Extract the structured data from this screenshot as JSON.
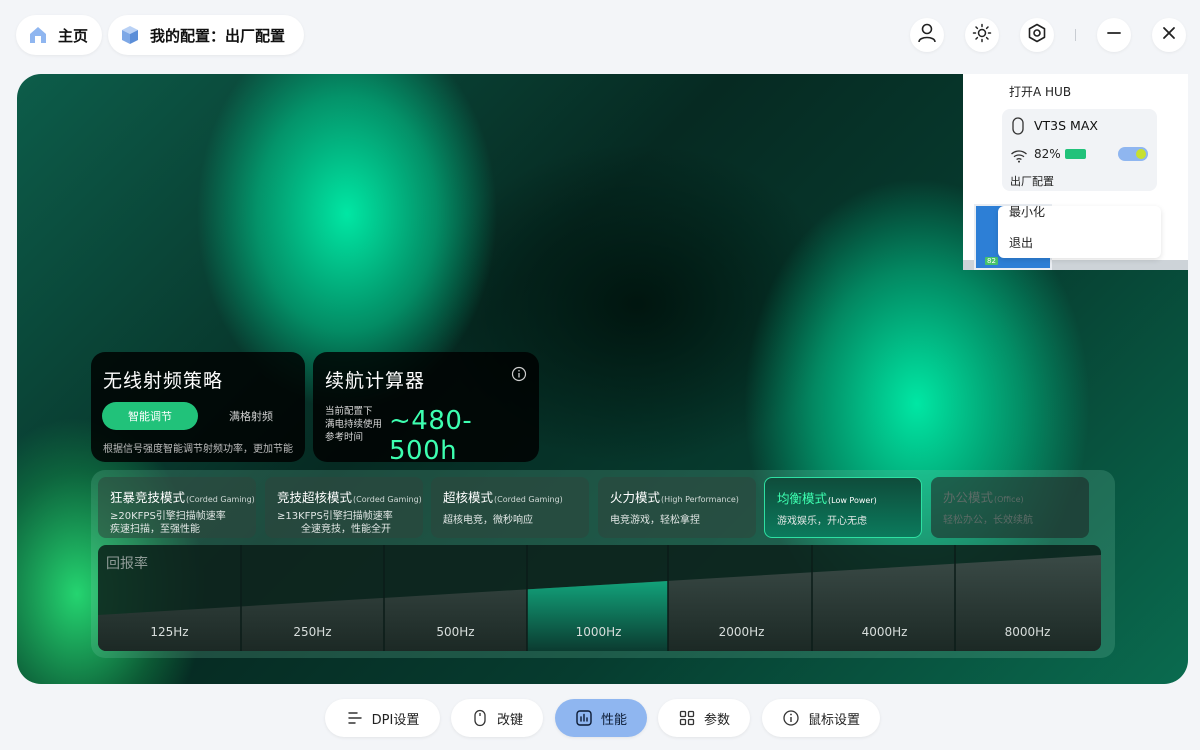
{
  "header": {
    "home_label": "主页",
    "config_label": "我的配置：出厂配置"
  },
  "wireless": {
    "title": "无线射频策略",
    "smart_label": "智能调节",
    "full_label": "满格射频",
    "description": "根据信号强度智能调节射频功率，更加节能"
  },
  "battery_calc": {
    "title": "续航计算器",
    "line1": "当前配置下",
    "line2": "满电持续使用",
    "line3": "参考时间",
    "value": "~480-500h"
  },
  "modes": [
    {
      "title": "狂暴竞技模式",
      "tag": "(Corded Gaming)",
      "desc1": "≥20KFPS引擎扫描帧速率",
      "desc2": "疾速扫描，至强性能"
    },
    {
      "title": "竞技超核模式",
      "tag": "(Corded Gaming)",
      "desc1": "≥13KFPS引擎扫描帧速率",
      "desc2": "全速竞技，性能全开"
    },
    {
      "title": "超核模式",
      "tag": "(Corded Gaming)",
      "desc1": "超核电竞，微秒响应",
      "desc2": ""
    },
    {
      "title": "火力模式",
      "tag": "(High Performance)",
      "desc1": "电竞游戏，轻松拿捏",
      "desc2": ""
    },
    {
      "title": "均衡模式",
      "tag": "(Low Power)",
      "desc1": "游戏娱乐，开心无虑",
      "desc2": ""
    },
    {
      "title": "办公模式",
      "tag": "(Office)",
      "desc1": "轻松办公，长效续航",
      "desc2": ""
    }
  ],
  "polling": {
    "title": "回报率",
    "rates": [
      "125Hz",
      "250Hz",
      "500Hz",
      "1000Hz",
      "2000Hz",
      "4000Hz",
      "8000Hz"
    ],
    "selected": "1000Hz"
  },
  "popup": {
    "open_hub": "打开A HUB",
    "device_name": "VT3S MAX",
    "battery": "82%",
    "config": "出厂配置",
    "minimize": "最小化",
    "exit": "退出",
    "thumb_tag": "82"
  },
  "bottom_nav": {
    "dpi": "DPI设置",
    "remap": "改键",
    "performance": "性能",
    "params": "参数",
    "mouse": "鼠标设置"
  },
  "colors": {
    "accent_green": "#21c27a",
    "value_green": "#3dffb0",
    "active_nav": "#8fb6f0"
  }
}
